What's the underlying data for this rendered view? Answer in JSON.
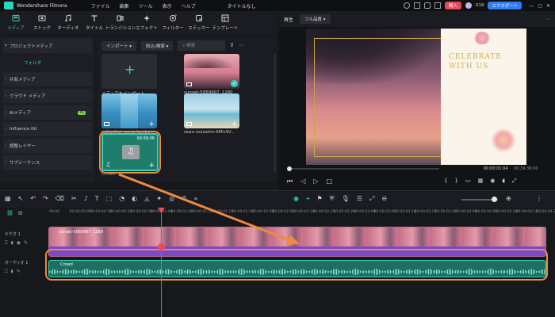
{
  "app": {
    "title": "Wondershare Filmora"
  },
  "menu": [
    "ファイル",
    "編集",
    "ツール",
    "表示",
    "ヘルプ"
  ],
  "title_center": "タイトルなし",
  "purchase_label": "購入",
  "credits": "018",
  "export_label": "エクスポート",
  "toolbar": [
    {
      "label": "メディア",
      "icon": "media-icon",
      "active": true
    },
    {
      "label": "ストック",
      "icon": "stock-icon"
    },
    {
      "label": "オーディオ",
      "icon": "music-note-icon"
    },
    {
      "label": "タイトル",
      "icon": "title-t-icon"
    },
    {
      "label": "トランジション",
      "icon": "transition-icon"
    },
    {
      "label": "エフェクト",
      "icon": "effects-icon"
    },
    {
      "label": "フィルター",
      "icon": "filter-icon"
    },
    {
      "label": "ステッカー",
      "icon": "sticker-icon"
    },
    {
      "label": "テンプレート",
      "icon": "template-icon"
    }
  ],
  "sidebar": {
    "items": [
      {
        "label": "プロジェクトメディア",
        "expand": "▾"
      },
      {
        "label": "フォルダ",
        "selected": true
      },
      {
        "label": "共有メディア",
        "expand": "›"
      },
      {
        "label": "クラウド メディア",
        "expand": "›"
      },
      {
        "label": "AIメディア",
        "expand": "›",
        "badge": "AI"
      },
      {
        "label": "Influence Kit",
        "expand": "›"
      },
      {
        "label": "調整レイヤー",
        "expand": "›"
      },
      {
        "label": "サブシーケンス",
        "expand": "›"
      }
    ]
  },
  "media_panel": {
    "import_label": "インポート",
    "sort_label": "絞込/検索",
    "search_placeholder": "検索",
    "items": [
      {
        "caption": "メディアをインポート",
        "kind": "import"
      },
      {
        "caption": "sunset-5959907_1280",
        "kind": "sunset",
        "checked": true
      },
      {
        "caption": "sebastian-pena-lambe...",
        "kind": "ocean"
      },
      {
        "caption": "sean-oulashin-KMn4V...",
        "kind": "beach"
      },
      {
        "caption": "Crowd",
        "kind": "audio",
        "duration": "00:39:36"
      }
    ]
  },
  "preview": {
    "tab_label": "再生",
    "quality": "フル品質",
    "card_text_line1": "CELEBRATE",
    "card_text_line2": "WITH US",
    "current_time": "00:00:01:04",
    "total_time": "00:39:36:00"
  },
  "timeline": {
    "ruler": [
      "00:00",
      "00:00:00:05",
      "00:00:00:10",
      "00:00:00:15",
      "00:00:00:20",
      "00:00:01:00",
      "00:00:01:05",
      "00:00:01:10",
      "00:00:01:15",
      "00:00:01:20",
      "00:00:02:00",
      "00:00:02:05",
      "00:00:02:10",
      "00:00:02:15",
      "00:00:02:20",
      "00:00:03:00",
      "00:00:03:05",
      "00:00:03:10",
      "00:00:03:15",
      "00:00:03:20",
      "00:00:04:00",
      "00:00:04:05",
      "00:00:04:10",
      "00:00:04:15",
      "00:00:04:20"
    ],
    "video_track_label": "ビデオ 1",
    "audio_track_label": "オーディオ 1",
    "video_clip": "sunset-5959907_1280",
    "audio_clip": "Crowd"
  },
  "colors": {
    "accent": "#2fd3c0",
    "callout": "#f08a3c",
    "audio_clip": "#1e6f5f",
    "video_clip": "#7a49c9"
  }
}
